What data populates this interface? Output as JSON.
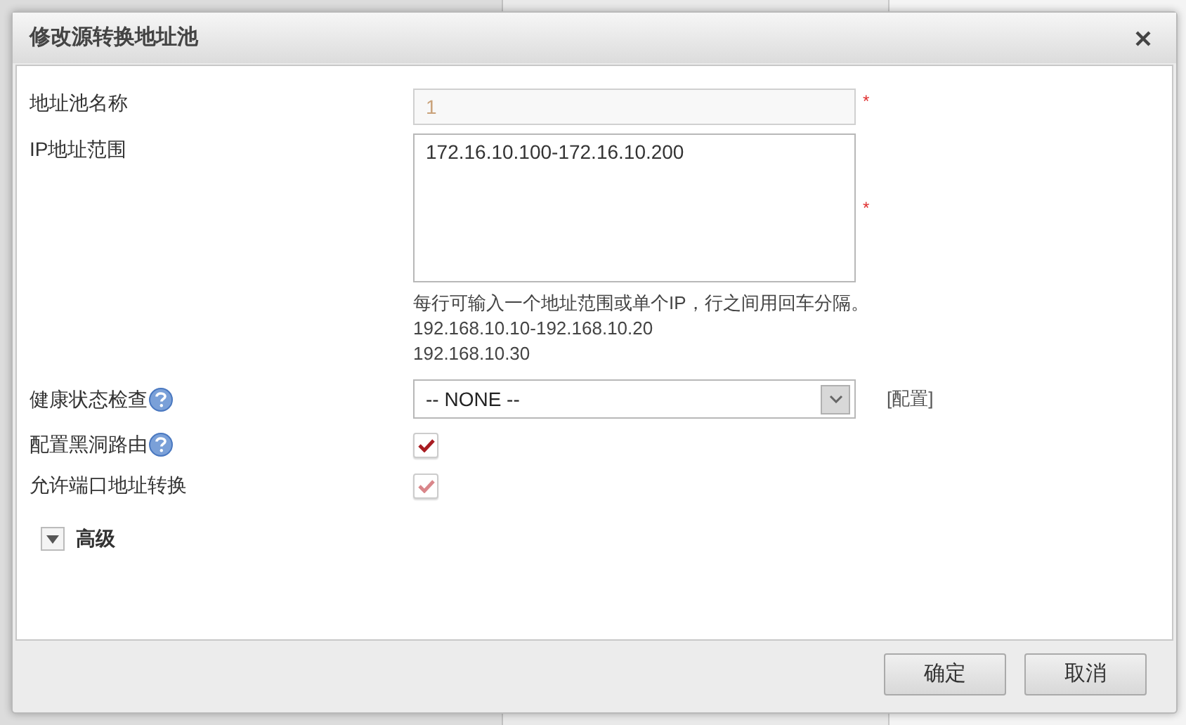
{
  "dialog": {
    "title": "修改源转换地址池",
    "fields": [
      {
        "kind": "text",
        "label": "地址池名称",
        "value": "1",
        "disabled": true,
        "required_mark": "*",
        "help": false
      },
      {
        "kind": "textarea",
        "label": "IP地址范围",
        "value": "172.16.10.100-172.16.10.200",
        "required_mark": "*",
        "help": false,
        "hint": [
          "每行可输入一个地址范围或单个IP，行之间用回车分隔。",
          "192.168.10.10-192.168.10.20",
          "192.168.10.30"
        ]
      },
      {
        "kind": "select",
        "label": "健康状态检查",
        "value": "-- NONE --",
        "help": true,
        "link": "[配置]"
      },
      {
        "kind": "checkbox",
        "label": "配置黑洞路由",
        "checked": true,
        "disabled": false,
        "help": true
      },
      {
        "kind": "checkbox",
        "label": "允许端口地址转换",
        "checked": true,
        "disabled": true,
        "help": false
      }
    ],
    "advanced": {
      "label": "高级",
      "expanded": false
    },
    "buttons": [
      "确定",
      "取消"
    ]
  }
}
